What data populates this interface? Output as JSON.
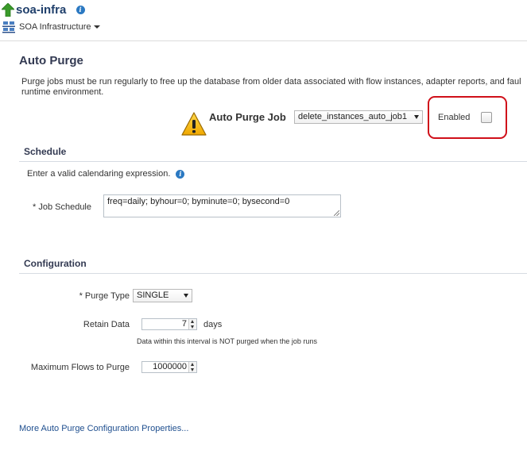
{
  "header": {
    "target_name": "soa-infra",
    "menu_label": "SOA Infrastructure",
    "info_glyph": "i"
  },
  "auto_purge": {
    "title": "Auto Purge",
    "description_line1": "Purge jobs must be run regularly to free up the database from older data associated with flow instances, adapter reports, and faul",
    "description_line2": "runtime environment.",
    "job_label": "Auto Purge Job",
    "job_selected": "delete_instances_auto_job1",
    "enabled_label": "Enabled",
    "enabled_checked": false
  },
  "schedule": {
    "heading": "Schedule",
    "hint": "Enter a valid calendaring expression.",
    "job_schedule_label": "* Job Schedule",
    "job_schedule_value": "freq=daily; byhour=0; byminute=0; bysecond=0"
  },
  "configuration": {
    "heading": "Configuration",
    "purge_type_label": "* Purge Type",
    "purge_type_value": "SINGLE",
    "retain_data_label": "Retain Data",
    "retain_data_value": "7",
    "retain_data_unit": "days",
    "retain_note": "Data within this interval is NOT purged when the job runs",
    "max_flows_label": "Maximum Flows to Purge",
    "max_flows_value": "1000000"
  },
  "footer": {
    "more_link": "More Auto Purge Configuration Properties..."
  },
  "colors": {
    "highlight_border": "#d0101a",
    "title_text": "#333a52",
    "link": "#1f4f8f",
    "info_icon": "#2b79c2",
    "up_arrow": "#3a9a2a",
    "warning": "#f0b400"
  },
  "icons": [
    "up-arrow-icon",
    "info-icon",
    "soa-infrastructure-icon",
    "warning-icon",
    "dropdown-caret-icon",
    "spinner-icon"
  ]
}
